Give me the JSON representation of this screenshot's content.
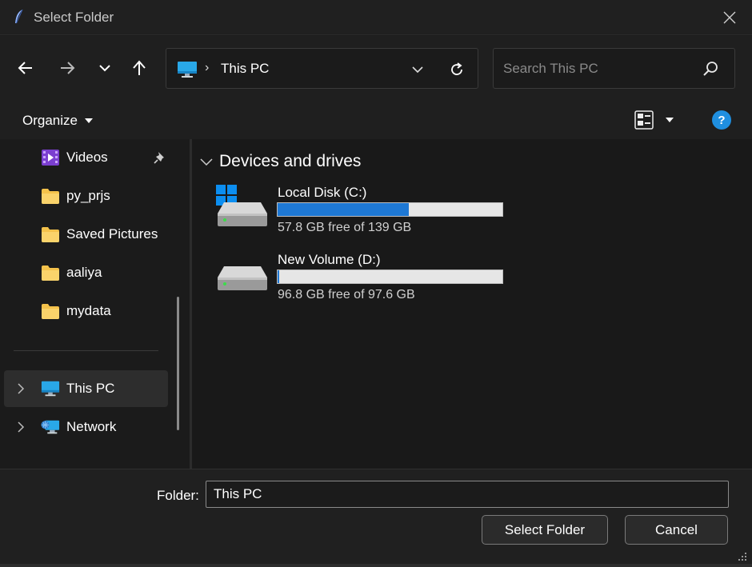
{
  "window": {
    "title": "Select Folder"
  },
  "address": {
    "location": "This PC",
    "separator": "›"
  },
  "search": {
    "placeholder": "Search This PC"
  },
  "commands": {
    "organize": "Organize"
  },
  "sidebar": {
    "items": [
      {
        "label": "Videos",
        "icon": "videos-folder-icon",
        "pinned": true
      },
      {
        "label": "py_prjs",
        "icon": "folder-icon"
      },
      {
        "label": "Saved Pictures",
        "icon": "folder-icon"
      },
      {
        "label": "aaliya",
        "icon": "folder-icon"
      },
      {
        "label": "mydata",
        "icon": "folder-icon"
      }
    ],
    "roots": [
      {
        "label": "This PC",
        "icon": "this-pc-icon",
        "selected": true
      },
      {
        "label": "Network",
        "icon": "network-icon"
      }
    ]
  },
  "content": {
    "group_title": "Devices and drives",
    "drives": [
      {
        "name": "Local Disk (C:)",
        "free_text": "57.8 GB free of 139 GB",
        "used_fraction": 0.584,
        "system": true
      },
      {
        "name": "New Volume (D:)",
        "free_text": "96.8 GB free of 97.6 GB",
        "used_fraction": 0.008,
        "system": false
      }
    ]
  },
  "footer": {
    "folder_label": "Folder:",
    "folder_value": "This PC",
    "select_button": "Select Folder",
    "cancel_button": "Cancel"
  },
  "colors": {
    "accent": "#1e78d4",
    "help": "#1f8fe0",
    "folder": "#f4c24b"
  }
}
